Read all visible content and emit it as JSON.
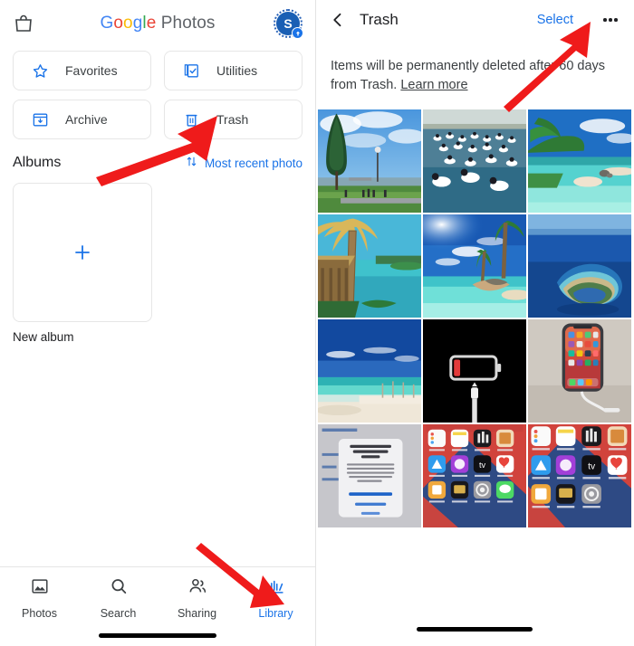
{
  "left": {
    "header": {
      "bag_icon": "shopping-bag-icon",
      "logo": {
        "g1": "G",
        "o1": "o",
        "o2": "o",
        "g2": "g",
        "l1": "l",
        "e1": "e",
        "word2": "Photos"
      },
      "avatar_initial": "S"
    },
    "cards": [
      {
        "label": "Favorites",
        "icon": "star-icon"
      },
      {
        "label": "Utilities",
        "icon": "checkbox-stack-icon"
      },
      {
        "label": "Archive",
        "icon": "archive-box-icon"
      },
      {
        "label": "Trash",
        "icon": "trash-icon"
      }
    ],
    "albums_title": "Albums",
    "sort_label": "Most recent photo",
    "sort_icon": "sort-arrows-icon",
    "new_album_label": "New album",
    "new_album_icon": "plus-icon",
    "nav": [
      {
        "label": "Photos",
        "icon": "photos-icon",
        "active": false
      },
      {
        "label": "Search",
        "icon": "search-icon",
        "active": false
      },
      {
        "label": "Sharing",
        "icon": "sharing-icon",
        "active": false
      },
      {
        "label": "Library",
        "icon": "library-icon",
        "active": true
      }
    ]
  },
  "right": {
    "back_icon": "chevron-left-icon",
    "title": "Trash",
    "select_label": "Select",
    "more_icon": "overflow-menu-icon",
    "note_text": "Items will be permanently deleted after 60 days from Trash. ",
    "note_link": "Learn more",
    "photos": [
      {
        "name": "pine-tree-waterfront-photo"
      },
      {
        "name": "pelicans-on-water-photo"
      },
      {
        "name": "tropical-beach-palms-photo"
      },
      {
        "name": "thatched-hut-palm-photo"
      },
      {
        "name": "sunny-lagoon-beach-photo"
      },
      {
        "name": "aerial-atoll-island-photo"
      },
      {
        "name": "white-sand-beach-photo"
      },
      {
        "name": "low-battery-charging-photo"
      },
      {
        "name": "iphone-on-desk-photo"
      },
      {
        "name": "icloud-backup-dialog-photo"
      },
      {
        "name": "iphone-home-screen-photo"
      },
      {
        "name": "iphone-home-screen-2-photo"
      }
    ]
  },
  "colors": {
    "accent": "#1a73e8",
    "arrow": "#ef1b1b",
    "text": "#202124",
    "muted": "#3c4043"
  }
}
